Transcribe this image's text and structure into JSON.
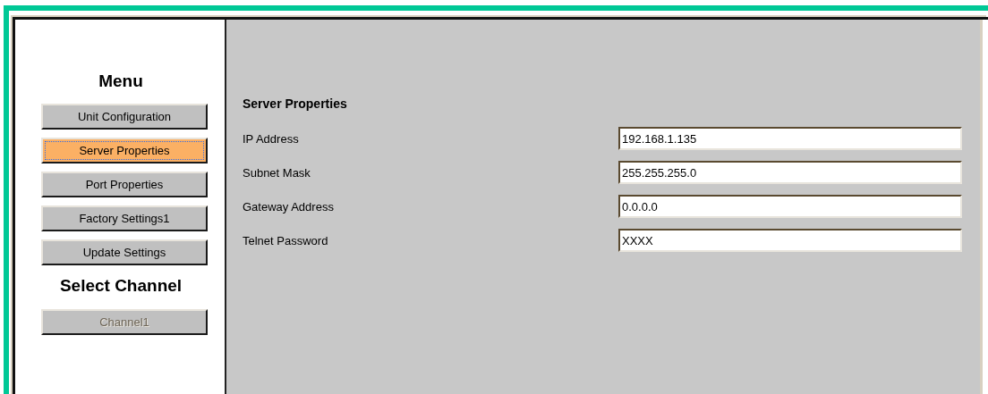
{
  "menu": {
    "title": "Menu",
    "items": [
      {
        "label": "Unit Configuration",
        "selected": false,
        "disabled": false
      },
      {
        "label": "Server Properties",
        "selected": true,
        "disabled": false
      },
      {
        "label": "Port Properties",
        "selected": false,
        "disabled": false
      },
      {
        "label": "Factory Settings1",
        "selected": false,
        "disabled": false
      },
      {
        "label": "Update Settings",
        "selected": false,
        "disabled": false
      }
    ]
  },
  "channel": {
    "title": "Select Channel",
    "items": [
      {
        "label": "Channel1",
        "selected": false,
        "disabled": true
      }
    ]
  },
  "form": {
    "title": "Server Properties",
    "fields": [
      {
        "label": "IP Address",
        "value": "192.168.1.135"
      },
      {
        "label": "Subnet Mask",
        "value": "255.255.255.0"
      },
      {
        "label": "Gateway Address",
        "value": "0.0.0.0"
      },
      {
        "label": "Telnet Password",
        "value": "XXXX"
      }
    ]
  }
}
